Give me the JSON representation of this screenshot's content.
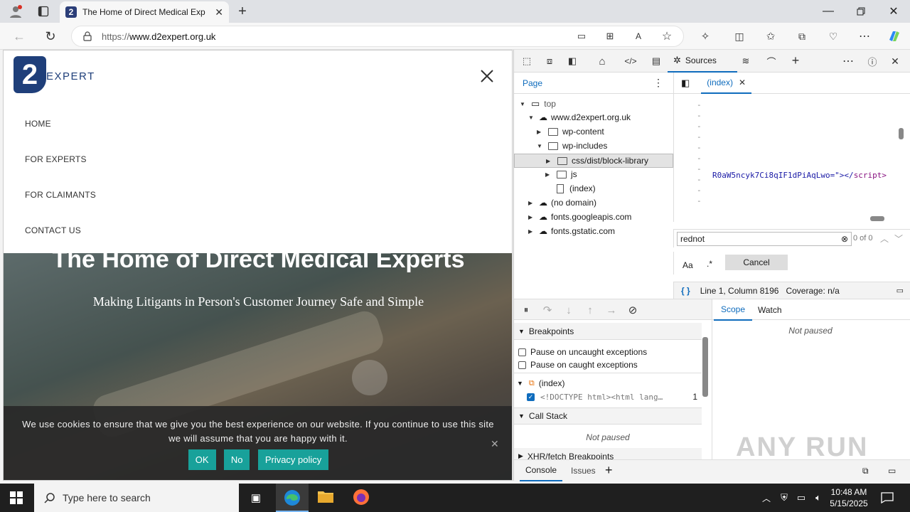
{
  "browser": {
    "tab_title": "The Home of Direct Medical Exp",
    "url_prefix": "https://",
    "url_host": "www.d2expert.org.uk"
  },
  "site": {
    "logo_text": "EXPERT",
    "logo_mark": "2",
    "nav": [
      "HOME",
      "FOR EXPERTS",
      "FOR CLAIMANTS",
      "CONTACT US"
    ],
    "hero_title": "The Home of Direct Medical Experts",
    "hero_subtitle": "Making Litigants in Person's Customer Journey Safe and Simple",
    "cookie_text": "We use cookies to ensure that we give you the best experience on our website. If you continue to use this site we will assume that you are happy with it.",
    "cookie_ok": "OK",
    "cookie_no": "No",
    "cookie_privacy": "Privacy policy",
    "accent": "#18a19a"
  },
  "devtools": {
    "sources_tab": "Sources",
    "page_tab": "Page",
    "file_tab": "(index)",
    "tree": {
      "top": "top",
      "domain": "www.d2expert.org.uk",
      "wp_content": "wp-content",
      "wp_includes": "wp-includes",
      "css_folder": "css/dist/block-library",
      "js_folder": "js",
      "index_file": "(index)",
      "no_domain": "(no domain)",
      "fonts_googleapis": "fonts.googleapis.com",
      "fonts_gstatic": "fonts.gstatic.com"
    },
    "code_line": "R0aW5ncyk7Ci8qIF1dPiAqLwo=\"></",
    "code_tag": "script>",
    "search_value": "rednot",
    "search_count": "0 of 0",
    "match_case": "Aa",
    "regex": ".*",
    "cancel": "Cancel",
    "status_position": "Line 1, Column 8196",
    "status_coverage": "Coverage: n/a",
    "scope_tab": "Scope",
    "watch_tab": "Watch",
    "not_paused": "Not paused",
    "breakpoints_label": "Breakpoints",
    "pause_uncaught": "Pause on uncaught exceptions",
    "pause_caught": "Pause on caught exceptions",
    "bp_file": "(index)",
    "bp_code": "<!DOCTYPE html><html lang…",
    "bp_line": "1",
    "call_stack_label": "Call Stack",
    "call_stack_status": "Not paused",
    "xhr_label": "XHR/fetch Breakpoints",
    "console_tab": "Console",
    "issues_tab": "Issues"
  },
  "taskbar": {
    "search_placeholder": "Type here to search",
    "time": "10:48 AM",
    "date": "5/15/2025"
  },
  "watermark": "ANY RUN"
}
